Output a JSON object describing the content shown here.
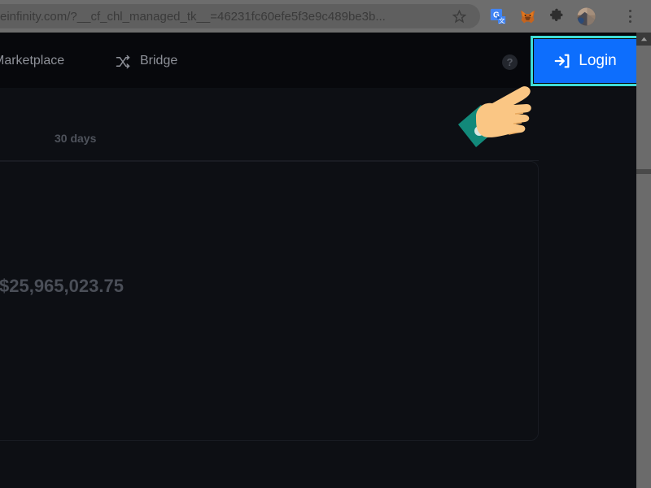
{
  "browser": {
    "url": "einfinity.com/?__cf_chl_managed_tk__=46231fc60efe5f3e9c489be3b...",
    "icons": {
      "bookmark": "star-icon",
      "translate": "google-translate-icon",
      "wallet": "metamask-fox-icon",
      "extensions": "puzzle-piece-icon",
      "profile": "profile-avatar-icon",
      "menu": "three-dot-menu-icon"
    }
  },
  "app": {
    "nav": {
      "marketplace": "Marketplace",
      "bridge": "Bridge",
      "bridge_icon": "shuffle-icon"
    },
    "help_label": "?",
    "login": {
      "label": "Login",
      "icon": "sign-in-icon",
      "bg_color": "#0d6efd",
      "highlight_color": "#3fdcd6"
    }
  },
  "content": {
    "filter_label": "30 days",
    "stat_amount": "$25,965,023.75"
  },
  "cursor": {
    "type": "pointing-hand-cursor",
    "skin_color": "#f9c880",
    "sleeve_color": "#12897a"
  },
  "scrollbar": {
    "thumb_color": "#6b6b6b",
    "track_color": "#3a3a3a"
  }
}
